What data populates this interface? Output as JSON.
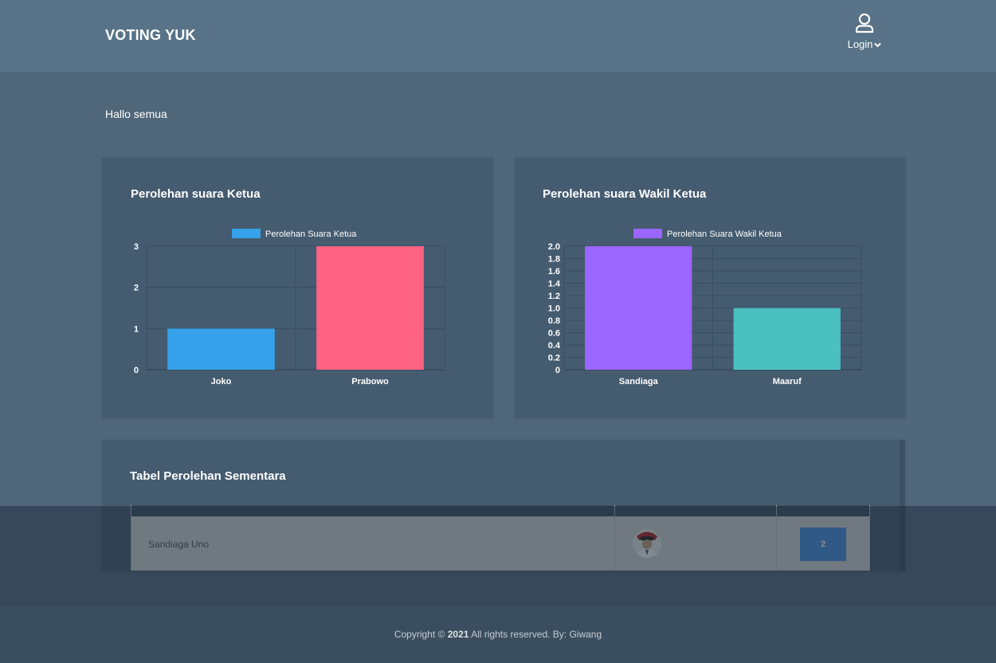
{
  "navbar": {
    "brand": "VOTING YUK",
    "login_label": "Login",
    "user_icon": "user-icon",
    "dropdown_icon": "chevron-down-icon"
  },
  "greeting": "Hallo semua",
  "charts": {
    "ketua_title": "Perolehan suara Ketua",
    "wakil_title": "Perolehan suara Wakil Ketua"
  },
  "chart_data": [
    {
      "type": "bar",
      "legend_label": "Perolehan Suara Ketua",
      "categories": [
        "Joko",
        "Prabowo"
      ],
      "values": [
        1,
        3
      ],
      "colors": [
        "#36a2eb",
        "#ff6384"
      ],
      "ylim": [
        0,
        3
      ],
      "yticks": [
        "0",
        "1",
        "2",
        "3"
      ],
      "legend": "top",
      "grid": true
    },
    {
      "type": "bar",
      "legend_label": "Perolehan Suara Wakil Ketua",
      "categories": [
        "Sandiaga",
        "Maaruf"
      ],
      "values": [
        2,
        1
      ],
      "colors": [
        "#9966ff",
        "#4bc0c0"
      ],
      "ylim": [
        0,
        2
      ],
      "yticks": [
        "0",
        "0.2",
        "0.4",
        "0.6",
        "0.8",
        "1.0",
        "1.2",
        "1.4",
        "1.6",
        "1.8",
        "2.0"
      ],
      "legend": "top",
      "grid": true
    }
  ],
  "table": {
    "title": "Tabel Perolehan Sementara",
    "rows": [
      {
        "name": "Sandiaga Uno",
        "votes": "2"
      }
    ]
  },
  "footer": {
    "prefix": "Copyright ©",
    "year": "2021",
    "suffix": "All rights reserved. By: Giwang"
  }
}
